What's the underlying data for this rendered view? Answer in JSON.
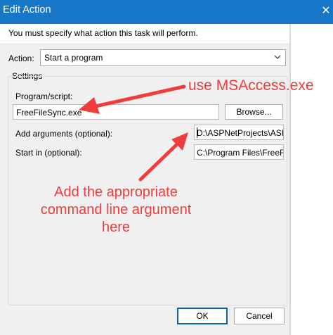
{
  "window": {
    "title": "Edit Action",
    "close_glyph": "✕"
  },
  "banner": {
    "message": "You must specify what action this task will perform."
  },
  "action": {
    "label": "Action:",
    "selected": "Start a program"
  },
  "settings": {
    "group_label": "Settings",
    "program": {
      "label": "Program/script:",
      "value": "FreeFileSync.exe"
    },
    "browse_label": "Browse...",
    "arguments": {
      "label": "Add arguments (optional):",
      "value": "D:\\ASPNetProjects\\ASPFile"
    },
    "start_in": {
      "label": "Start in (optional):",
      "value": "C:\\Program Files\\FreeFileS"
    }
  },
  "buttons": {
    "ok": "OK",
    "cancel": "Cancel"
  },
  "annotations": {
    "program_note": "use MSAccess.exe",
    "arguments_note": "Add the appropriate command line argument here",
    "color": "#ef3d3d"
  },
  "icons": {
    "close": "close-icon",
    "dropdown": "chevron-down-icon"
  }
}
